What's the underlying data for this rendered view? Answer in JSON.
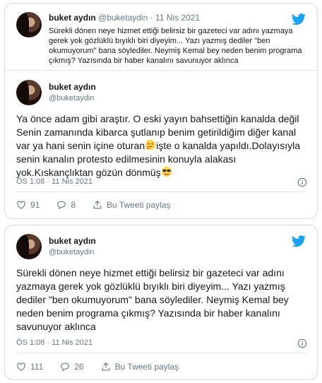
{
  "tweet1": {
    "quoted": {
      "name": "buket aydın",
      "handle": "@buketaydin",
      "dot": "·",
      "date": "11 Nis 2021",
      "text": "Sürekli dönen neye hizmet ettiği belirsiz bir gazeteci var adını yazmaya gerek yok gözlüklü bıyıklı biri diyeyim... Yazı yazmış dediler \"ben okumuyorum\" bana söylediler. Neymiş Kemal bey neden benim programa çıkmış? Yazısında bir haber kanalını savunuyor aklınca"
    },
    "author": {
      "name": "buket aydın",
      "handle": "@buketaydin"
    },
    "text_part1": "Ya önce adam gibi araştır. O eski yayın bahsettiğin kanalda değil Senin zamanında kibarca şutlanıp benim getirildiğim diğer kanal var ya hani senin içine oturan",
    "text_part2": "işte o kanalda yapıldı.Dolayısıyla senin kanalın protesto edilmesinin konuyla alakası yok.Kıskançlıktan gözün dönmüş",
    "timestamp": "ÖS 1:08 · 11 Nis 2021",
    "likes": "91",
    "replies": "8",
    "share_label": "Bu Tweeti paylaş"
  },
  "tweet2": {
    "author": {
      "name": "buket aydın",
      "handle": "@buketaydin"
    },
    "text": "Sürekli dönen neye hizmet ettiği belirsiz bir gazeteci var adını yazmaya gerek yok gözlüklü bıyıklı biri diyeyim... Yazı yazmış dediler \"ben okumuyorum\" bana söylediler. Neymiş Kemal bey neden benim programa çıkmış? Yazısında bir haber kanalını savunuyor aklınca",
    "timestamp": "ÖS 1:08 · 11 Nis 2021",
    "likes": "111",
    "replies": "26",
    "share_label": "Bu Tweeti paylaş"
  },
  "colors": {
    "twitter_blue": "#1da1f2",
    "secondary_text": "#657786",
    "border": "#d3d9de"
  },
  "icons": [
    "twitter-bird-icon",
    "info-icon",
    "heart-icon",
    "reply-icon",
    "share-icon",
    "thinking-face-emoji",
    "sunglasses-emoji"
  ]
}
